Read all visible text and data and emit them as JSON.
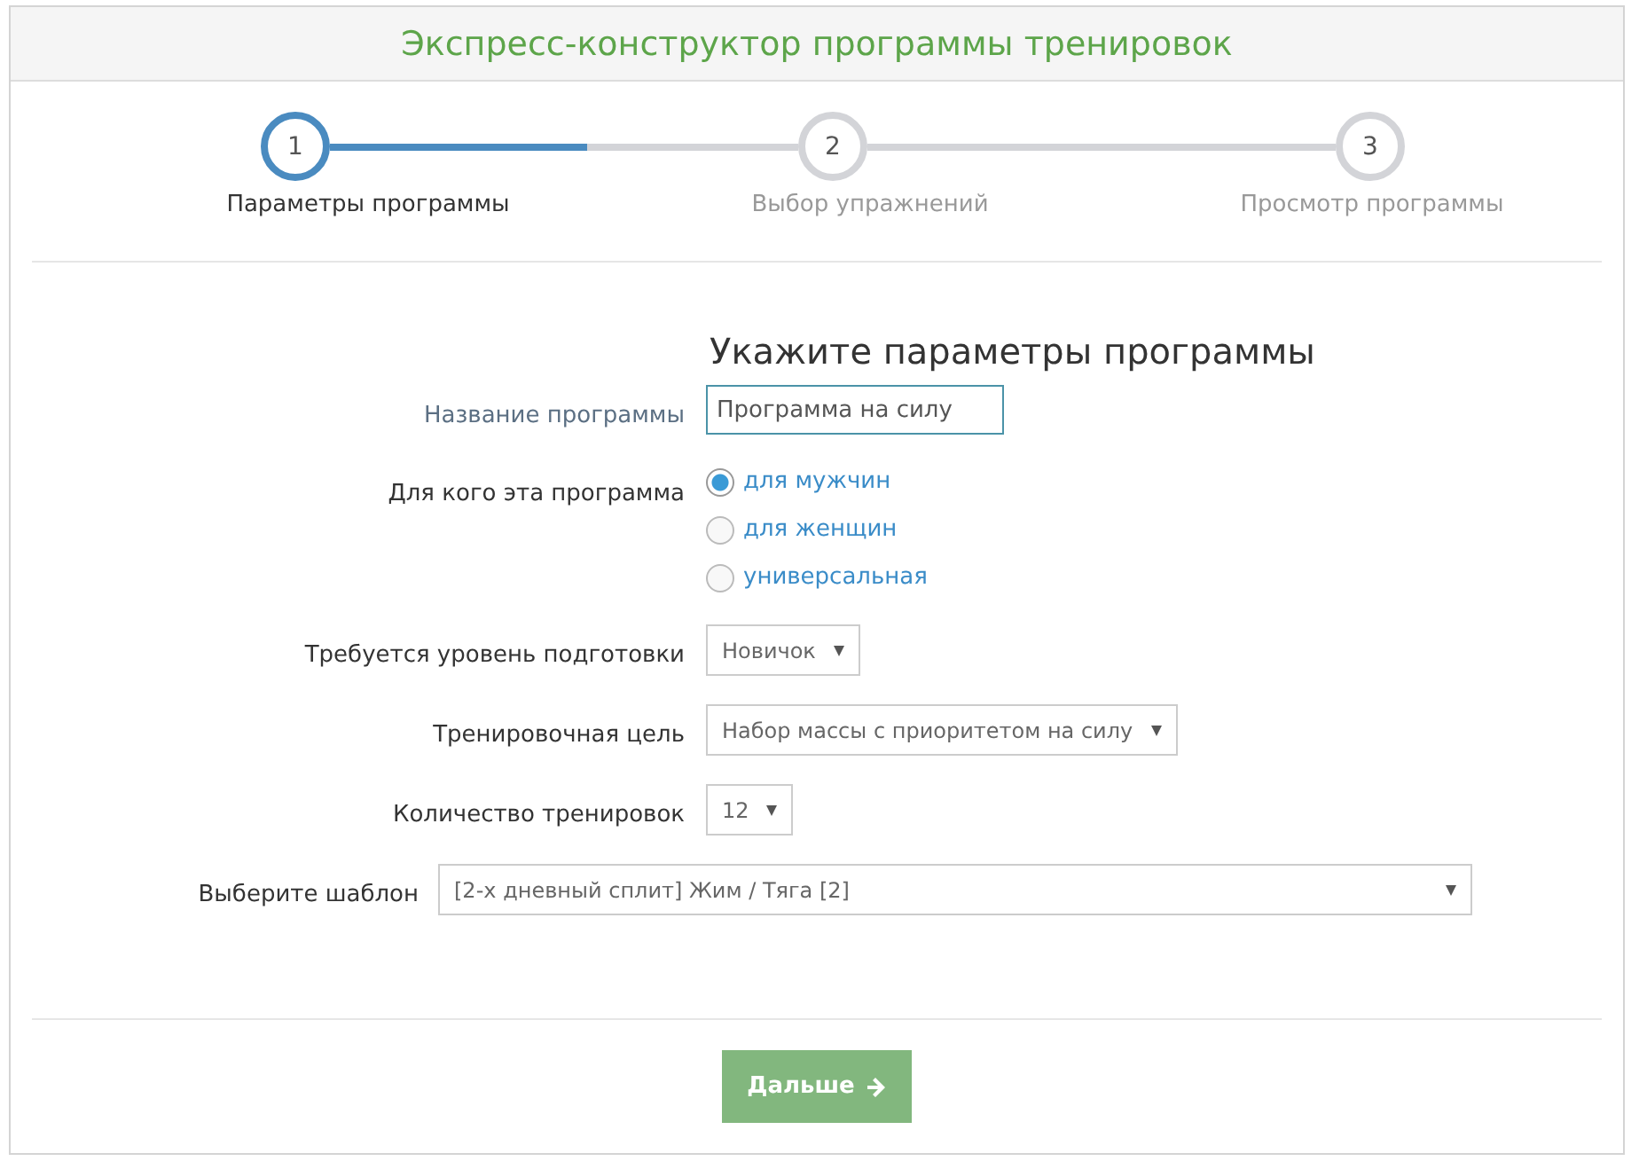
{
  "title": "Экспресс-конструктор программы тренировок",
  "steps": [
    {
      "number": "1",
      "label": "Параметры программы",
      "selected": true
    },
    {
      "number": "2",
      "label": "Выбор упражнений",
      "selected": false
    },
    {
      "number": "3",
      "label": "Просмотр программы",
      "selected": false
    }
  ],
  "connectors": [
    {
      "level": 0.55
    },
    {
      "level": 0
    }
  ],
  "form": {
    "heading": "Укажите параметры программы",
    "fields": [
      {
        "kind": "text",
        "label": "Название программы",
        "value": "Программа на силу",
        "focused": true
      },
      {
        "kind": "radio",
        "label": "Для кого эта программа",
        "options": [
          {
            "label": "для мужчин",
            "selected": true
          },
          {
            "label": "для женщин",
            "selected": false
          },
          {
            "label": "универсальная",
            "selected": false
          }
        ]
      },
      {
        "kind": "select",
        "label": "Требуется уровень подготовки",
        "value": "Новичок"
      },
      {
        "kind": "select",
        "label": "Тренировочная цель",
        "value": "Набор массы с приоритетом на силу"
      },
      {
        "kind": "select",
        "label": "Количество тренировок",
        "value": "12"
      },
      {
        "kind": "wide-select",
        "label": "Выберите шаблон",
        "value": "[2-х дневный сплит] Жим / Тяга [2]"
      }
    ]
  },
  "next_button": {
    "label": "Дальше"
  }
}
